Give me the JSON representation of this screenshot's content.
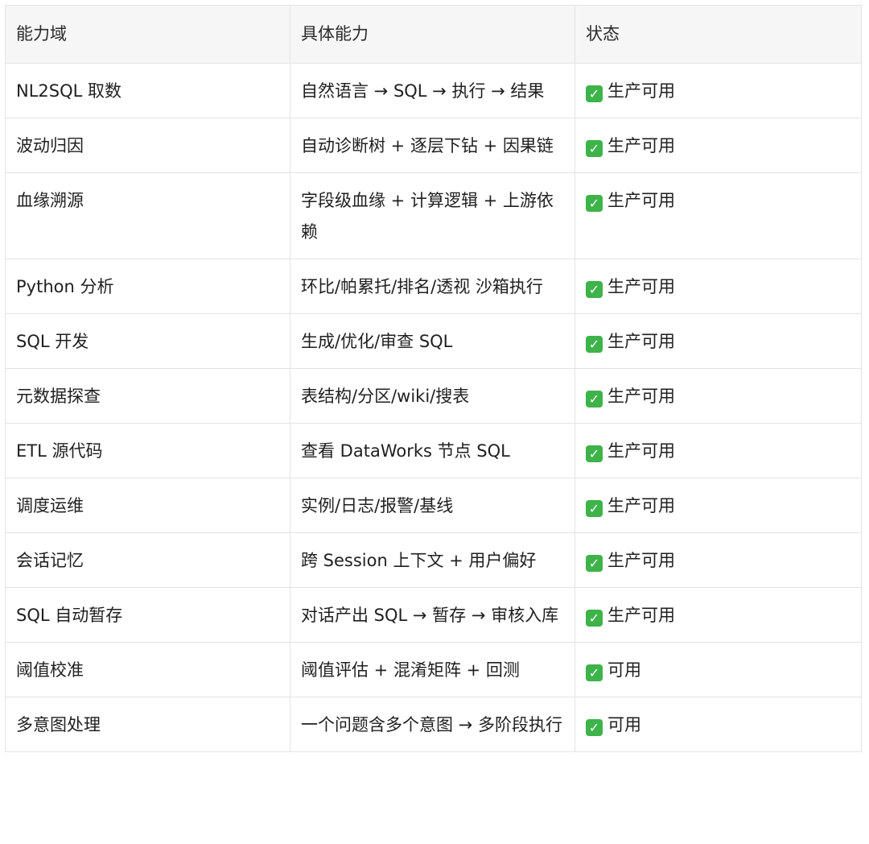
{
  "table": {
    "headers": [
      "能力域",
      "具体能力",
      "状态"
    ],
    "check_icon": "✓",
    "rows": [
      {
        "domain": "NL2SQL 取数",
        "capability": "自然语言 → SQL → 执行 → 结果",
        "status": "生产可用"
      },
      {
        "domain": "波动归因",
        "capability": "自动诊断树 + 逐层下钻 + 因果链",
        "status": "生产可用"
      },
      {
        "domain": "血缘溯源",
        "capability": "字段级血缘 + 计算逻辑 + 上游依赖",
        "status": "生产可用"
      },
      {
        "domain": "Python 分析",
        "capability": "环比/帕累托/排名/透视 沙箱执行",
        "status": "生产可用"
      },
      {
        "domain": "SQL 开发",
        "capability": "生成/优化/审查 SQL",
        "status": "生产可用"
      },
      {
        "domain": "元数据探查",
        "capability": "表结构/分区/wiki/搜表",
        "status": "生产可用"
      },
      {
        "domain": "ETL 源代码",
        "capability": "查看 DataWorks 节点 SQL",
        "status": "生产可用"
      },
      {
        "domain": "调度运维",
        "capability": "实例/日志/报警/基线",
        "status": "生产可用"
      },
      {
        "domain": "会话记忆",
        "capability": "跨 Session 上下文 + 用户偏好",
        "status": "生产可用"
      },
      {
        "domain": "SQL 自动暂存",
        "capability": "对话产出 SQL → 暂存 → 审核入库",
        "status": "生产可用"
      },
      {
        "domain": "阈值校准",
        "capability": "阈值评估 + 混淆矩阵 + 回测",
        "status": "可用"
      },
      {
        "domain": "多意图处理",
        "capability": "一个问题含多个意图 → 多阶段执行",
        "status": "可用"
      }
    ]
  }
}
